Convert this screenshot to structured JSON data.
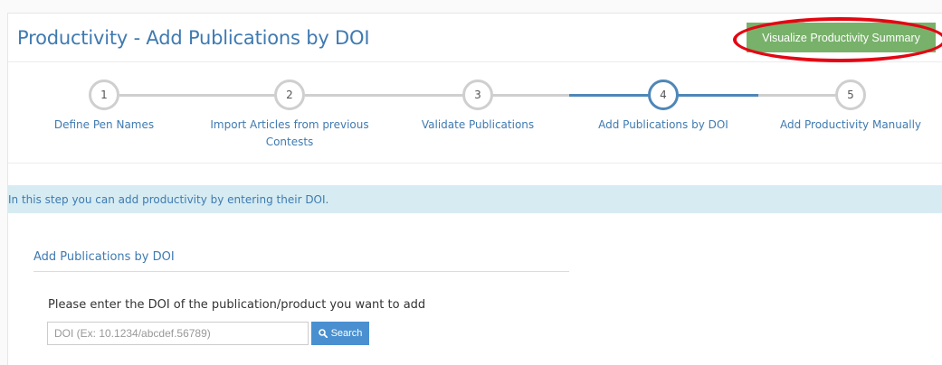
{
  "header": {
    "title": "Productivity - Add Publications by DOI",
    "visualize_button": "Visualize Productivity Summary"
  },
  "stepper": {
    "active_step": 4,
    "steps": [
      {
        "number": "1",
        "label": "Define Pen Names"
      },
      {
        "number": "2",
        "label": "Import Articles from previous Contests"
      },
      {
        "number": "3",
        "label": "Validate Publications"
      },
      {
        "number": "4",
        "label": "Add Publications by DOI"
      },
      {
        "number": "5",
        "label": "Add Productivity Manually"
      }
    ]
  },
  "info": {
    "message": "In this step you can add productivity by entering their DOI."
  },
  "form": {
    "section_title": "Add Publications by DOI",
    "prompt": "Please enter the DOI of the publication/product you want to add",
    "doi_placeholder": "DOI (Ex: 10.1234/abcdef.56789)",
    "search_label": "Search"
  },
  "colors": {
    "accent_blue": "#3f7ab1",
    "active_step_border": "#4e87b8",
    "visualize_green": "#78b16a",
    "highlight_red": "#e30613",
    "info_bg": "#d6ecf2",
    "search_blue": "#4a90d0"
  },
  "icons": {
    "search_button": "search-icon"
  }
}
